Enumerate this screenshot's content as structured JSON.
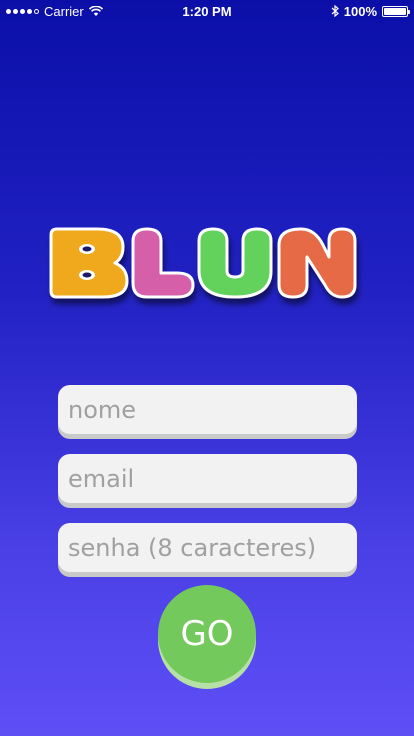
{
  "status_bar": {
    "carrier": "Carrier",
    "time": "1:20 PM",
    "battery": "100%",
    "battery_level": 1.0
  },
  "logo": {
    "text": "BLUN",
    "letters": [
      {
        "char": "B",
        "color": "#f0a81e"
      },
      {
        "char": "L",
        "color": "#d65fa9"
      },
      {
        "char": "U",
        "color": "#62d25c"
      },
      {
        "char": "N",
        "color": "#e56a44"
      }
    ]
  },
  "form": {
    "name_placeholder": "nome",
    "email_placeholder": "email",
    "password_placeholder": "senha (8 caracteres)",
    "submit_label": "GO"
  },
  "colors": {
    "background_top": "#0b0fa8",
    "background_bottom": "#5e4ff5",
    "go_button": "#74c95c",
    "field_bg": "#f2f2f2"
  }
}
